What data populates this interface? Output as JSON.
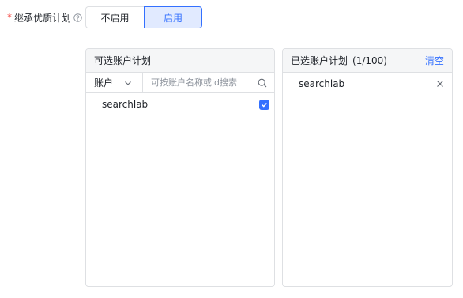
{
  "field": {
    "required_mark": "*",
    "label": "继承优质计划"
  },
  "segment": {
    "options": [
      "不启用",
      "启用"
    ],
    "selected": "启用"
  },
  "left_panel": {
    "title": "可选账户计划",
    "select_value": "账户",
    "search_placeholder": "可按账户名称或id搜索",
    "items": [
      {
        "name": "searchlab",
        "checked": true
      }
    ]
  },
  "right_panel": {
    "title": "已选账户计划",
    "count": "(1/100)",
    "clear_label": "清空",
    "items": [
      {
        "name": "searchlab"
      }
    ]
  },
  "colors": {
    "accent": "#3370ff",
    "required": "#f54a45"
  }
}
